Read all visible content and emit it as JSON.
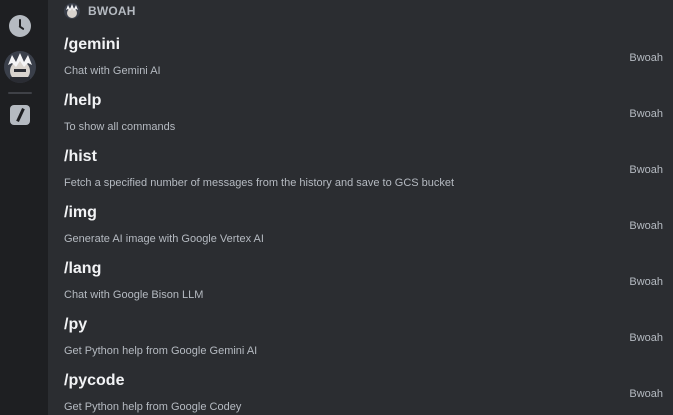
{
  "sidebar": {
    "recent_icon": "clock-icon",
    "bot_avatar": "bot-avatar",
    "commands_icon": "slash-command-icon"
  },
  "group": {
    "title": "BWOAH"
  },
  "commands": [
    {
      "name": "/gemini",
      "description": "Chat with Gemini AI",
      "app": "Bwoah"
    },
    {
      "name": "/help",
      "description": "To show all commands",
      "app": "Bwoah"
    },
    {
      "name": "/hist",
      "description": "Fetch a specified number of messages from the history and save to GCS bucket",
      "app": "Bwoah"
    },
    {
      "name": "/img",
      "description": "Generate AI image with Google Vertex AI",
      "app": "Bwoah"
    },
    {
      "name": "/lang",
      "description": "Chat with Google Bison LLM",
      "app": "Bwoah"
    },
    {
      "name": "/py",
      "description": "Get Python help from Google Gemini AI",
      "app": "Bwoah"
    },
    {
      "name": "/pycode",
      "description": "Get Python help from Google Codey",
      "app": "Bwoah"
    }
  ],
  "colors": {
    "background": "#2b2d31",
    "rail": "#1e1f22",
    "text_primary": "#f2f3f5",
    "text_secondary": "#b5bac1"
  }
}
